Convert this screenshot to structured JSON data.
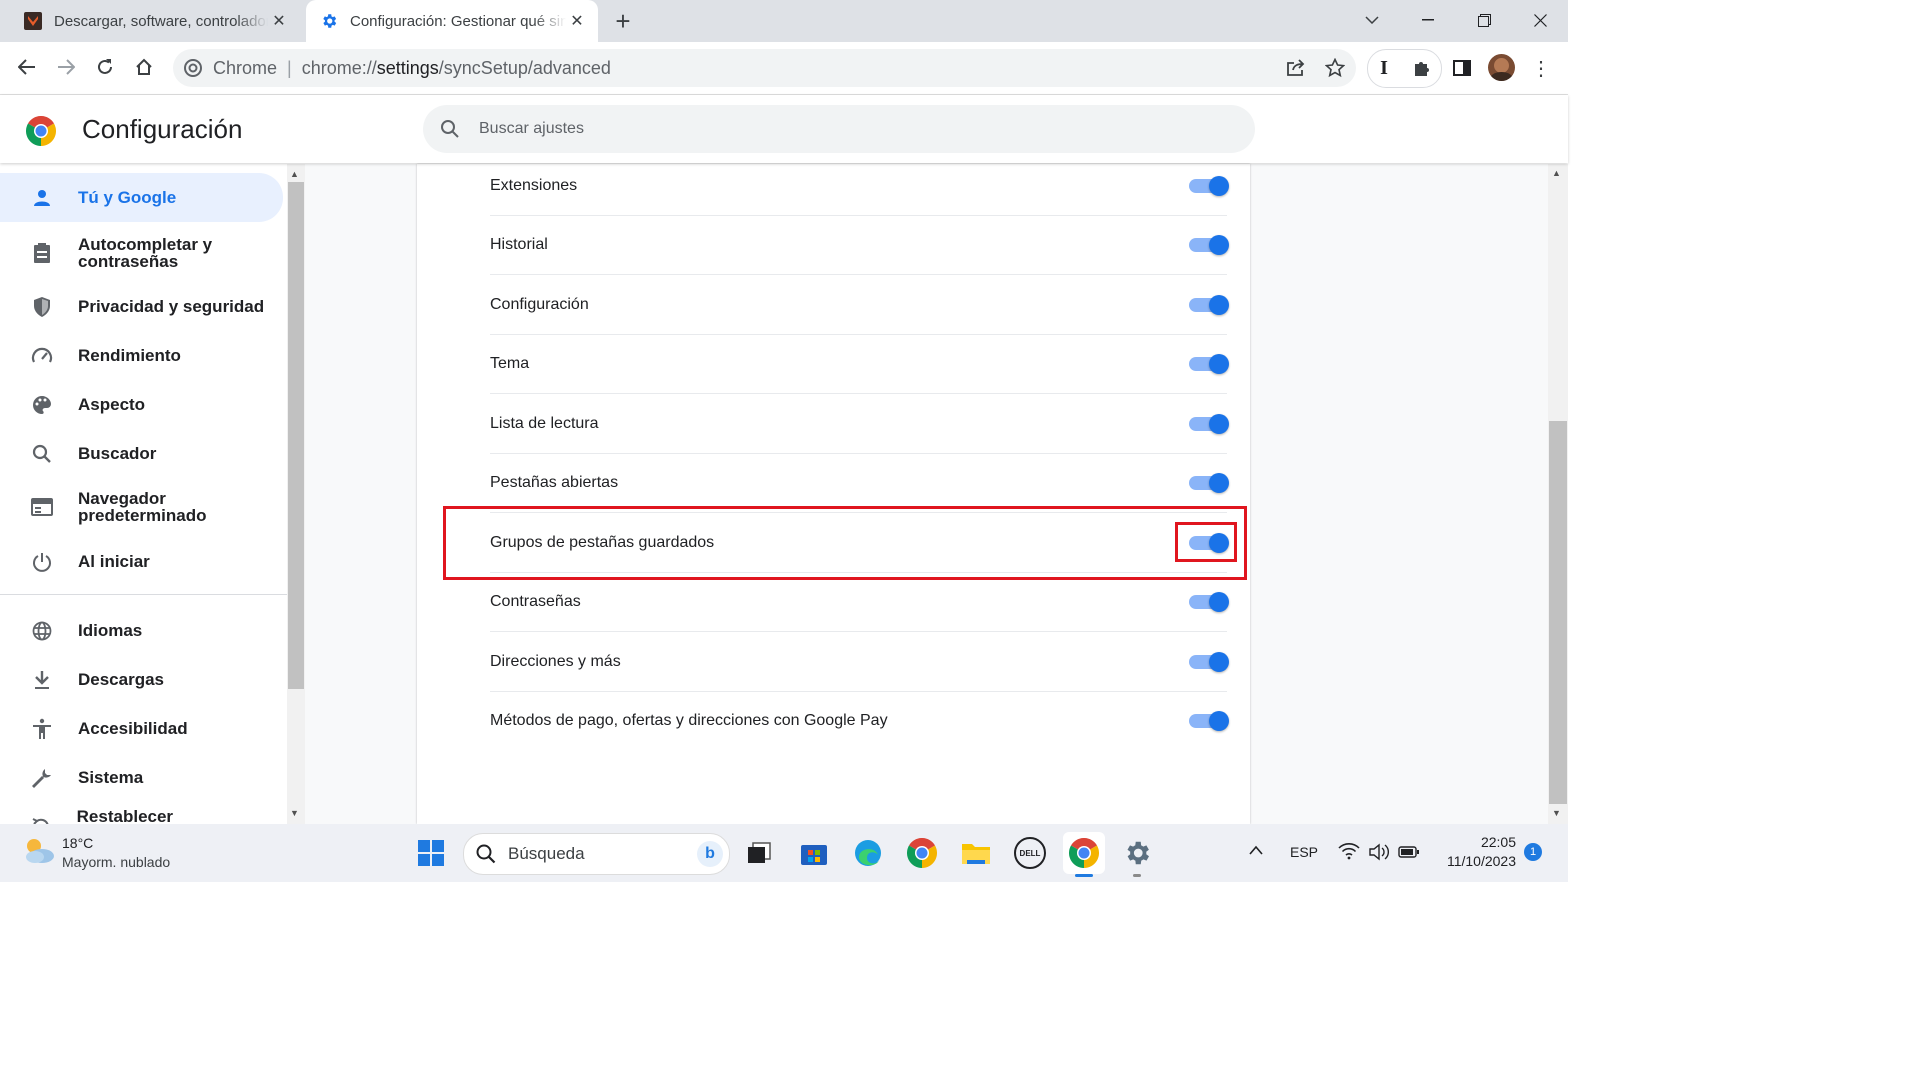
{
  "window": {
    "tabs": [
      {
        "title": "Descargar, software, controladores",
        "favicon_color": "#c0392b",
        "active": false
      },
      {
        "title": "Configuración: Gestionar qué sincronizar",
        "favicon_color": "#1a73e8",
        "active": true
      }
    ],
    "new_tab_symbol": "+",
    "controls": [
      "chevron-down-icon",
      "minimize-icon",
      "restore-icon",
      "close-icon"
    ]
  },
  "toolbar": {
    "omnibox": {
      "scheme_label": "Chrome",
      "url_prefix": "chrome://",
      "url_host": "settings",
      "url_path": "/syncSetup/advanced"
    }
  },
  "header": {
    "title": "Configuración",
    "search_placeholder": "Buscar ajustes"
  },
  "sidebar": {
    "items": [
      {
        "label": "Tú y Google",
        "icon": "person-icon",
        "active": true
      },
      {
        "label": "Autocompletar y contraseñas",
        "icon": "clipboard-icon"
      },
      {
        "label": "Privacidad y seguridad",
        "icon": "shield-icon"
      },
      {
        "label": "Rendimiento",
        "icon": "speedometer-icon"
      },
      {
        "label": "Aspecto",
        "icon": "palette-icon"
      },
      {
        "label": "Buscador",
        "icon": "search-icon"
      },
      {
        "label": "Navegador predeterminado",
        "icon": "browser-icon"
      },
      {
        "label": "Al iniciar",
        "icon": "power-icon"
      },
      {
        "label": "Idiomas",
        "icon": "globe-icon"
      },
      {
        "label": "Descargas",
        "icon": "download-icon"
      },
      {
        "label": "Accesibilidad",
        "icon": "accessibility-icon"
      },
      {
        "label": "Sistema",
        "icon": "wrench-icon"
      },
      {
        "label": "Restablecer configuración",
        "icon": "reset-icon"
      }
    ]
  },
  "sync": {
    "rows": [
      {
        "label": "Extensiones",
        "enabled": true
      },
      {
        "label": "Historial",
        "enabled": true
      },
      {
        "label": "Configuración",
        "enabled": true
      },
      {
        "label": "Tema",
        "enabled": true
      },
      {
        "label": "Lista de lectura",
        "enabled": true
      },
      {
        "label": "Pestañas abiertas",
        "enabled": true
      },
      {
        "label": "Grupos de pestañas guardados",
        "enabled": true,
        "highlighted": true
      },
      {
        "label": "Contraseñas",
        "enabled": true
      },
      {
        "label": "Direcciones y más",
        "enabled": true
      },
      {
        "label": "Métodos de pago, ofertas y direcciones con Google Pay",
        "enabled": true
      }
    ],
    "highlight_color": "#e0161f"
  },
  "taskbar": {
    "weather": {
      "temp": "18°C",
      "desc": "Mayorm. nublado"
    },
    "search_placeholder": "Búsqueda",
    "language": "ESP",
    "time": "22:05",
    "date": "11/10/2023",
    "notification_count": "1"
  },
  "colors": {
    "accent": "#1a73e8",
    "toggle_track": "#8ab4f8"
  }
}
